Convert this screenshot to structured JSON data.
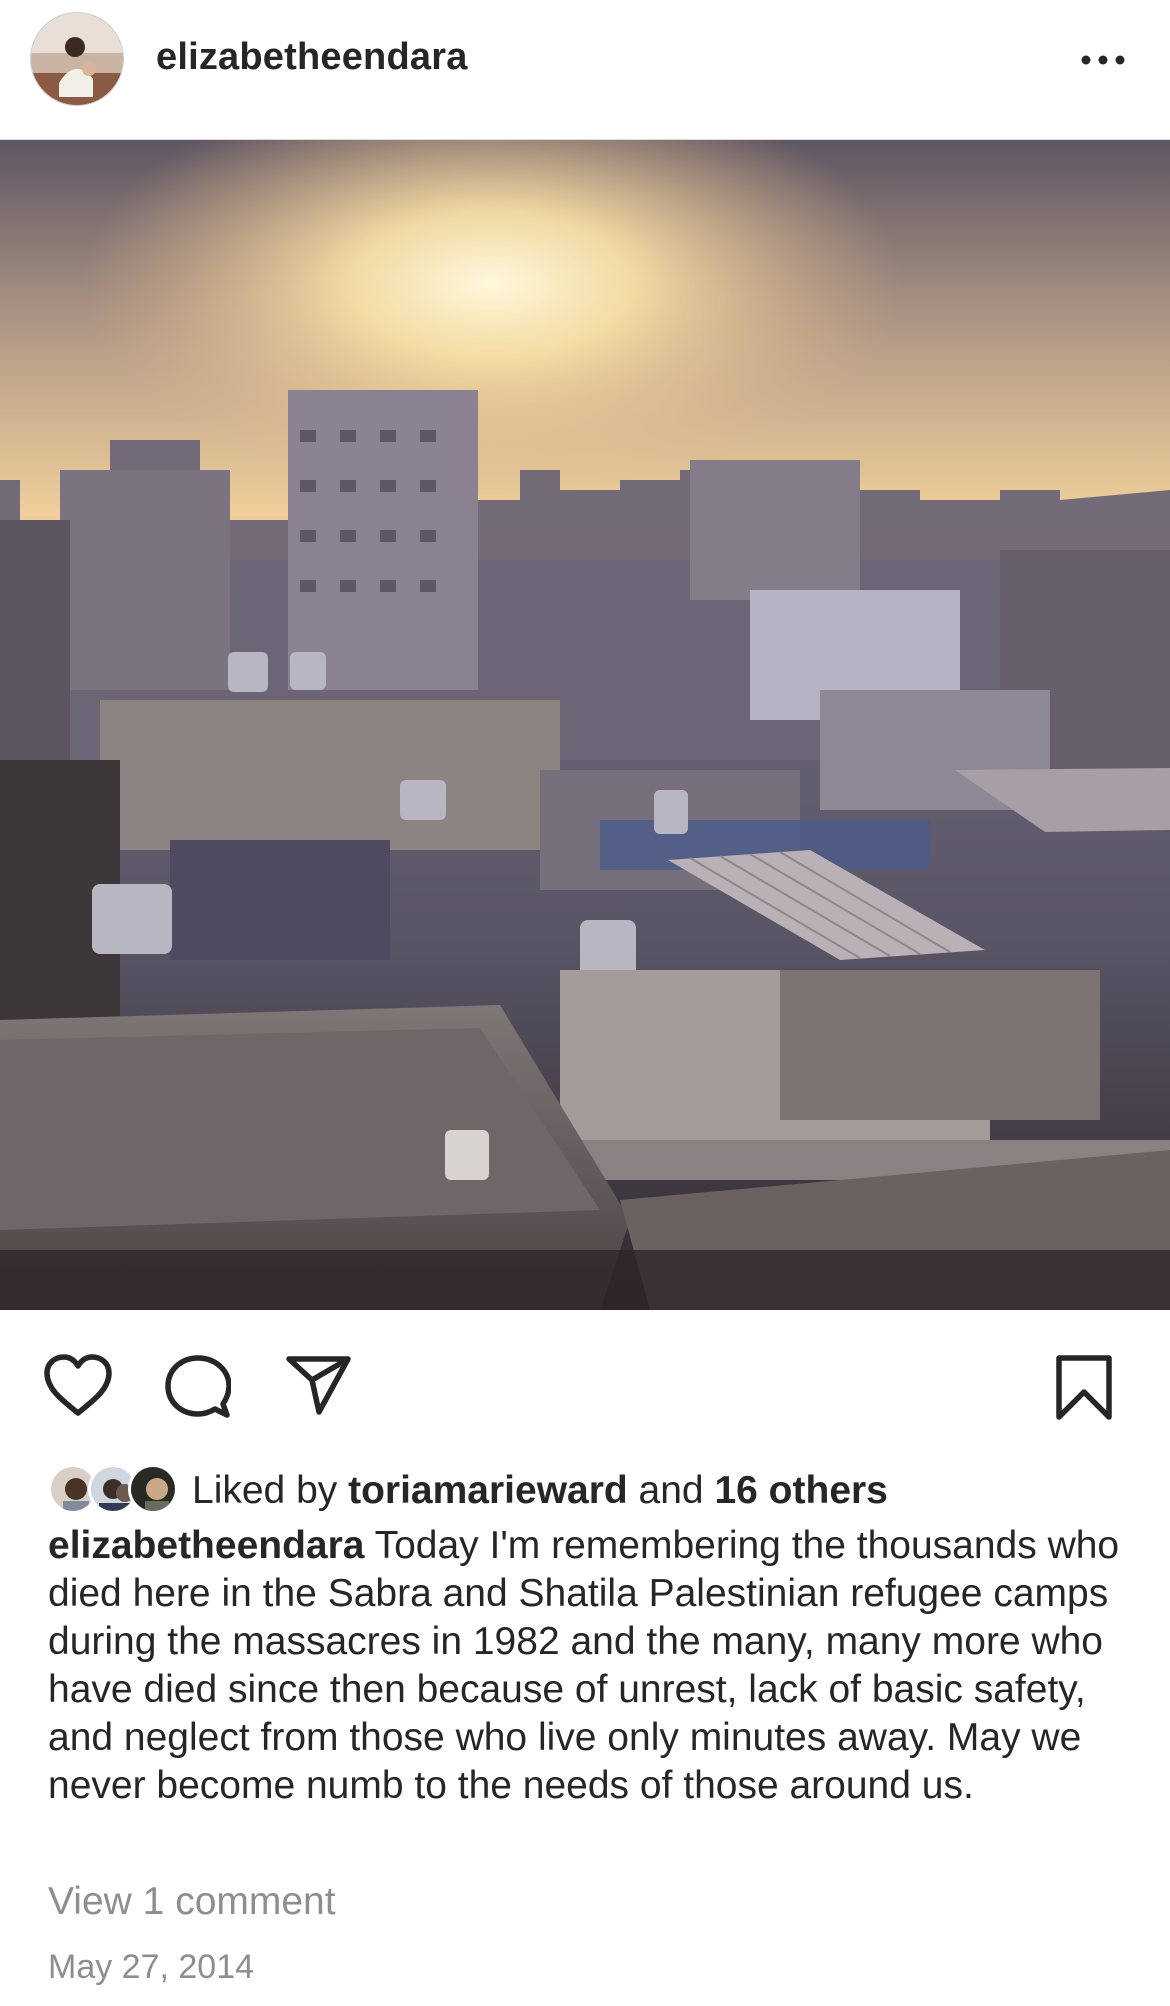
{
  "post": {
    "username": "elizabetheendara",
    "avatar_icon": "profile-photo",
    "more_icon": "more-horizontal-icon"
  },
  "actions": {
    "like_icon": "heart-icon",
    "comment_icon": "comment-icon",
    "share_icon": "send-icon",
    "save_icon": "bookmark-icon"
  },
  "likes": {
    "prefix": "Liked by ",
    "liker": "toriamarieward",
    "conjunction": " and ",
    "others": "16 others"
  },
  "caption": {
    "username": "elizabetheendara",
    "text": "Today I'm remembering the thousands who died here in the Sabra and Shatila Palestinian refugee camps during the massacres in 1982 and the many, many more who have died since then because of unrest, lack of basic safety, and neglect from those who live only minutes away. May we never become numb to the needs of those around us."
  },
  "comments": {
    "view_label": "View 1 comment"
  },
  "date": "May 27, 2014",
  "colors": {
    "text": "#262626",
    "secondary_text": "#8e8e8e",
    "divider": "#dbdbdb",
    "sky_top": "#5e5663",
    "sun": "#fff3c4"
  }
}
